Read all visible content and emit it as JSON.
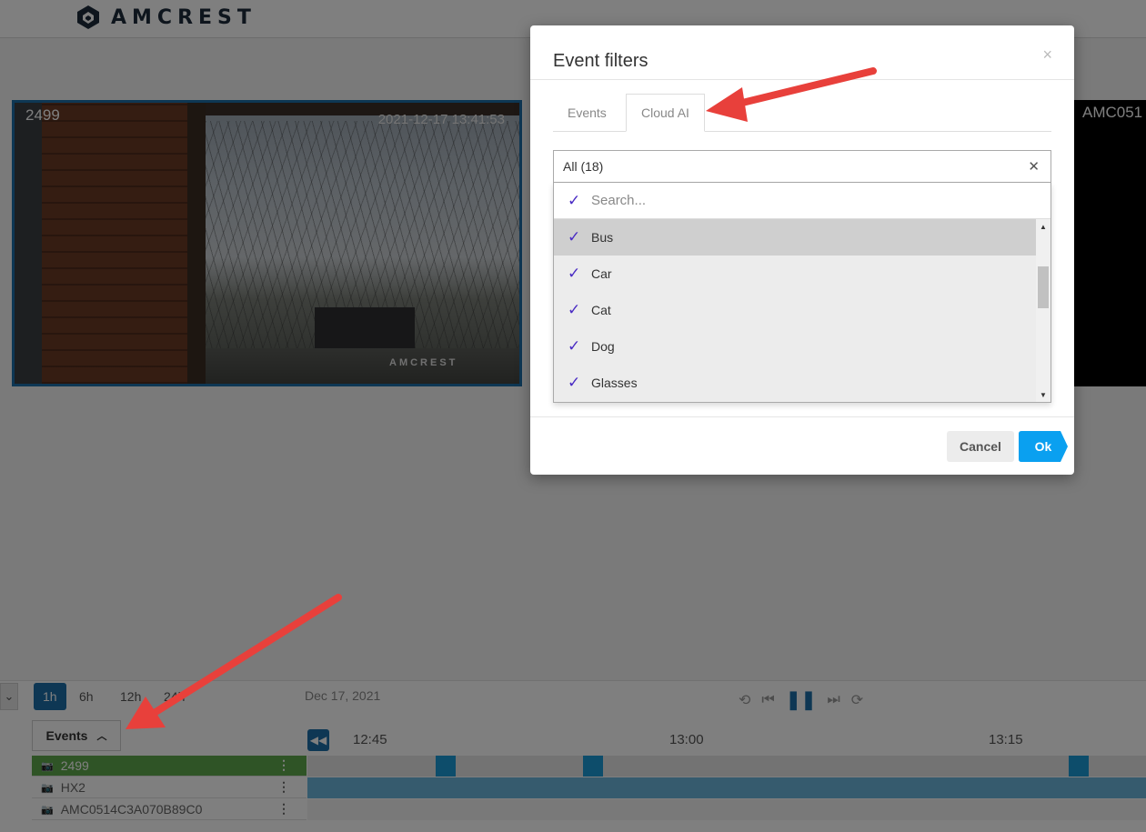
{
  "header": {
    "brand": "AMCREST"
  },
  "cameras": {
    "main": {
      "label": "2499",
      "timestamp": "2021-12-17 13:41:53",
      "watermark": "AMCREST"
    },
    "right": {
      "label": "AMC051"
    }
  },
  "timeline": {
    "ranges": [
      "1h",
      "6h",
      "12h",
      "24h"
    ],
    "active_range": "1h",
    "date": "Dec 17, 2021",
    "events_label": "Events",
    "ticks": [
      "12:45",
      "13:00",
      "13:15"
    ],
    "rows": [
      {
        "name": "2499",
        "active": true
      },
      {
        "name": "HX2",
        "active": false
      },
      {
        "name": "AMC0514C3A070B89C0",
        "active": false
      }
    ]
  },
  "modal": {
    "title": "Event filters",
    "close": "×",
    "tabs": [
      {
        "label": "Events",
        "active": false
      },
      {
        "label": "Cloud AI",
        "active": true
      }
    ],
    "select": {
      "value": "All (18)",
      "clear": "✕"
    },
    "search_placeholder": "Search...",
    "items": [
      {
        "label": "Bus",
        "checked": true,
        "highlighted": true
      },
      {
        "label": "Car",
        "checked": true,
        "highlighted": false
      },
      {
        "label": "Cat",
        "checked": true,
        "highlighted": false
      },
      {
        "label": "Dog",
        "checked": true,
        "highlighted": false
      },
      {
        "label": "Glasses",
        "checked": true,
        "highlighted": false
      }
    ],
    "cancel_label": "Cancel",
    "ok_label": "Ok"
  },
  "colors": {
    "accent": "#1d6fa8",
    "ok_button": "#0aa0f0",
    "check": "#4a2cc4",
    "annotation_arrow": "#e8403b",
    "active_row": "#5fa84d"
  }
}
